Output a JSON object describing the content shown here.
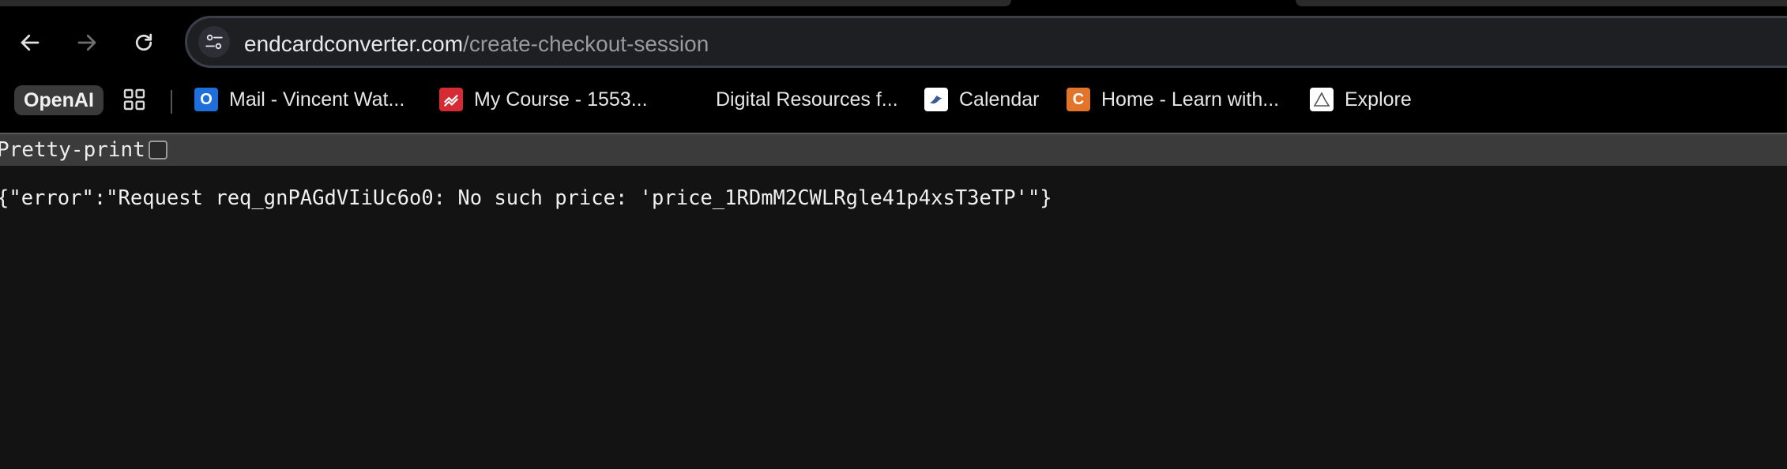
{
  "browser": {
    "url_domain": "endcardconverter.com",
    "url_path": "/create-checkout-session"
  },
  "bookmarks": [
    {
      "label": "OpenAI",
      "icon": "openai-badge"
    },
    {
      "label": "",
      "icon": "apps-grid-icon"
    },
    {
      "label": "Mail - Vincent Wat...",
      "icon": "outlook-icon",
      "color": "#1e6fd9"
    },
    {
      "label": "My Course - 1553...",
      "icon": "course-icon",
      "color": "#d42b35"
    },
    {
      "label": "Digital Resources f...",
      "icon": ""
    },
    {
      "label": "Calendar",
      "icon": "calendar-bird-icon"
    },
    {
      "label": "Home - Learn with...",
      "icon": "learn-c-icon",
      "color": "#e2742c"
    },
    {
      "label": "Explore",
      "icon": "explore-icon"
    }
  ],
  "viewer": {
    "pretty_print_label": "Pretty-print",
    "pretty_print_checked": false,
    "json_text": "{\"error\":\"Request req_gnPAGdVIiUc6o0: No such price: 'price_1RDmM2CWLRgle41p4xsT3eTP'\"}"
  }
}
